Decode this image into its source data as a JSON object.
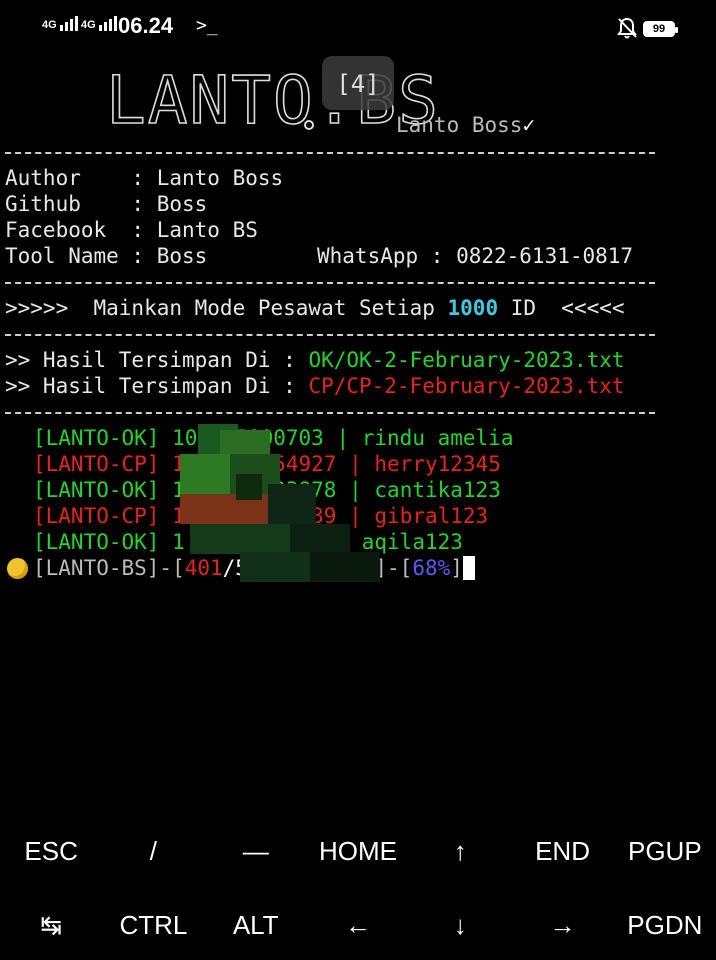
{
  "status_bar": {
    "signal1_label": "4G",
    "signal2_label": "4G",
    "time": "06.24",
    "terminal_indicator": ">_",
    "battery_level": "99",
    "icons": [
      "signal-icon",
      "signal-icon",
      "terminal-icon",
      "notifications-off-icon",
      "battery-icon"
    ]
  },
  "banner": {
    "logo_text": "LANTO.BS",
    "tab_count": "[4]",
    "tagline": "Lanto Boss",
    "tagline_mark": "✓"
  },
  "info": {
    "author": "Author    : Lanto Boss",
    "github": "Github    : Boss",
    "facebook": "Facebook  : Lanto BS",
    "tool_name": "Tool Name : Boss",
    "whatsapp": "WhatsApp : 0822-6131-0817"
  },
  "notice": {
    "prefix": ">>>>>  Mainkan Mode Pesawat Setiap ",
    "count": "1000",
    "suffix": " ID  <<<<<"
  },
  "results": {
    "ok_label": ">> Hasil Tersimpan Di : ",
    "ok_file": "OK/OK-2-February-2023.txt",
    "cp_label": ">> Hasil Tersimpan Di : ",
    "cp_file": "CP/CP-2-February-2023.txt"
  },
  "log": [
    {
      "tag": "[LANTO-OK]",
      "id": "100055900703",
      "sep": " | ",
      "password": "rindu amelia",
      "status": "ok"
    },
    {
      "tag": "[LANTO-CP]",
      "id": "10    6354927",
      "sep": " | ",
      "password": "herry12345",
      "status": "cp"
    },
    {
      "tag": "[LANTO-OK]",
      "id": "10    6403878",
      "sep": " | ",
      "password": "cantika123",
      "status": "ok"
    },
    {
      "tag": "[LANTO-CP]",
      "id": "1     9924239",
      "sep": " | ",
      "password": "gibral123",
      "status": "cp"
    },
    {
      "tag": "[LANTO-OK]",
      "id": "1           ",
      "sep": " | ",
      "password": "aqila123",
      "status": "ok"
    }
  ],
  "progress": {
    "prefix": "[LANTO-BS]-[",
    "current": "401",
    "total": "/584]",
    "middle": "-[ ",
    "middle_end": "]-[",
    "percent": "68%",
    "close": "]"
  },
  "extra_keys": {
    "row1": [
      "ESC",
      "/",
      "—",
      "HOME",
      "↑",
      "END",
      "PGUP"
    ],
    "row2": [
      "↹",
      "CTRL",
      "ALT",
      "←",
      "↓",
      "→",
      "PGDN"
    ]
  },
  "colors": {
    "ok": "#22d42c",
    "cp": "#e6231f",
    "highlight": "#40c8e0",
    "percent": "#5b5bf0"
  }
}
